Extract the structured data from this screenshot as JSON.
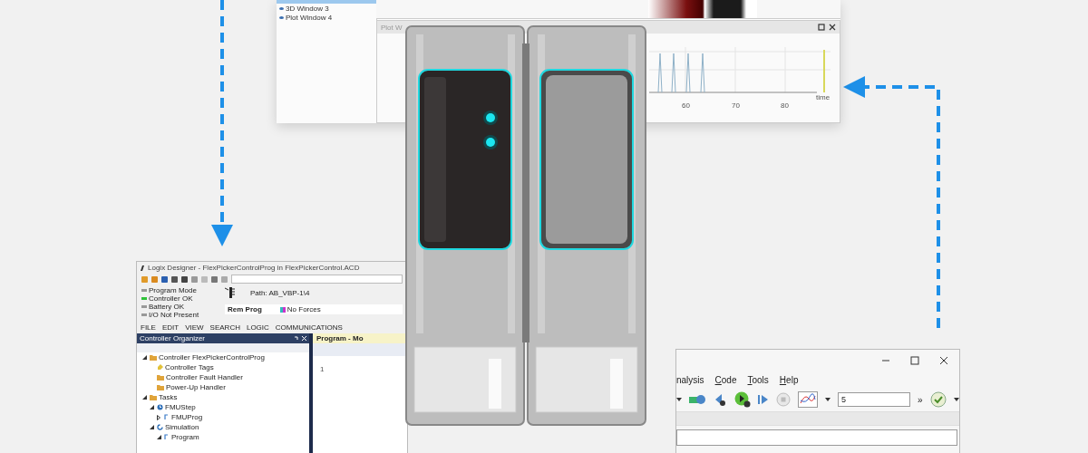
{
  "plot_app": {
    "window_list": [
      {
        "label": "3D Window 3"
      },
      {
        "label": "Plot Window 4"
      }
    ],
    "plot_window": {
      "title": "Plot W",
      "x_tick_labels": [
        "60",
        "70",
        "80"
      ],
      "axis_label": "time"
    }
  },
  "logix_window": {
    "title": "Logix Designer - FlexPickerControlProg in FlexPickerControl.ACD",
    "status": [
      {
        "label": "Program Mode",
        "on": false
      },
      {
        "label": "Controller OK",
        "on": true
      },
      {
        "label": "Battery OK",
        "on": false
      },
      {
        "label": "I/O Not Present",
        "on": false
      }
    ],
    "path": "Path: AB_VBP-1\\4",
    "mode": "Rem Prog",
    "forces": "No Forces",
    "menu": [
      "FILE",
      "EDIT",
      "VIEW",
      "SEARCH",
      "LOGIC",
      "COMMUNICATIONS"
    ],
    "organizer": {
      "title": "Controller Organizer",
      "tree": [
        {
          "label": "Controller FlexPickerControlProg",
          "kind": "folder",
          "expanded": true,
          "children": [
            {
              "label": "Controller Tags",
              "kind": "tag"
            },
            {
              "label": "Controller Fault Handler",
              "kind": "folder"
            },
            {
              "label": "Power-Up Handler",
              "kind": "folder"
            }
          ]
        },
        {
          "label": "Tasks",
          "kind": "folder",
          "expanded": true,
          "children": [
            {
              "label": "FMUStep",
              "kind": "task",
              "expanded": true,
              "children": [
                {
                  "label": "FMUProg",
                  "kind": "program",
                  "expanded": false
                }
              ]
            },
            {
              "label": "Simulation",
              "kind": "cycle",
              "expanded": true,
              "children": [
                {
                  "label": "Program",
                  "kind": "program",
                  "expanded": true
                }
              ]
            }
          ]
        }
      ]
    },
    "editor": {
      "tab": "Program - Mo",
      "line_number": "1"
    }
  },
  "ide_window": {
    "menu": [
      "nalysis",
      "Code",
      "Tools",
      "Help"
    ],
    "step_field": {
      "value": "5"
    },
    "more": "»"
  }
}
